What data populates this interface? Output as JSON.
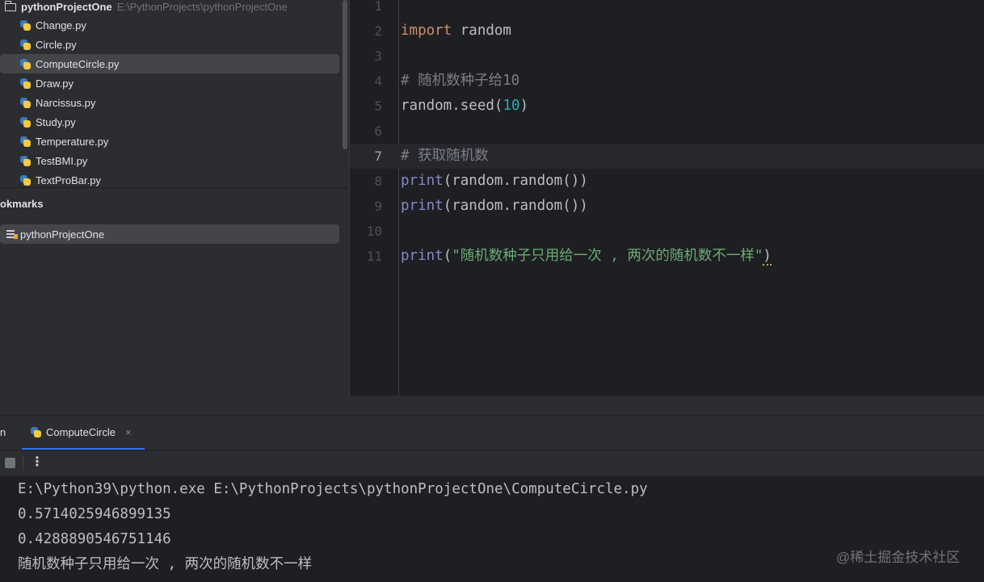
{
  "project": {
    "root_name": "pythonProjectOne",
    "root_path": "E:\\PythonProjects\\pythonProjectOne",
    "files": [
      "Change.py",
      "Circle.py",
      "ComputeCircle.py",
      "Draw.py",
      "Narcissus.py",
      "Study.py",
      "Temperature.py",
      "TestBMI.py",
      "TextProBar.py"
    ],
    "selected_file": "ComputeCircle.py"
  },
  "bookmarks": {
    "title": "okmarks",
    "item": "pythonProjectOne"
  },
  "editor": {
    "current_line": 7,
    "line_numbers": [
      "1",
      "2",
      "3",
      "4",
      "5",
      "6",
      "7",
      "8",
      "9",
      "10",
      "11"
    ],
    "l2_kw": "import",
    "l2_rest": " random",
    "l4_comment": "# 随机数种子给10",
    "l5_a": "random.seed(",
    "l5_num": "10",
    "l5_b": ")",
    "l7_comment": "# 获取随机数",
    "l8_fn": "print",
    "l8_rest": "(random.random())",
    "l9_fn": "print",
    "l9_rest": "(random.random())",
    "l11_fn": "print",
    "l11_open": "(",
    "l11_str": "\"随机数种子只用给一次 , 两次的随机数不一样\"",
    "l11_close": ")"
  },
  "run": {
    "label": "n",
    "tab_label": "ComputeCircle",
    "close_glyph": "×",
    "more_glyph": "⋮",
    "output": [
      "E:\\Python39\\python.exe E:\\PythonProjects\\pythonProjectOne\\ComputeCircle.py",
      "0.5714025946899135",
      "0.4288890546751146",
      "随机数种子只用给一次 , 两次的随机数不一样"
    ]
  },
  "watermark": "@稀土掘金技术社区",
  "colors": {
    "background": "#2b2d30",
    "editor_bg": "#1e1f22",
    "keyword": "#cf8e6d",
    "number": "#2aacb8",
    "string": "#6aab73",
    "builtin": "#8888c6",
    "comment": "#7a7e85",
    "selection": "#43454a"
  }
}
